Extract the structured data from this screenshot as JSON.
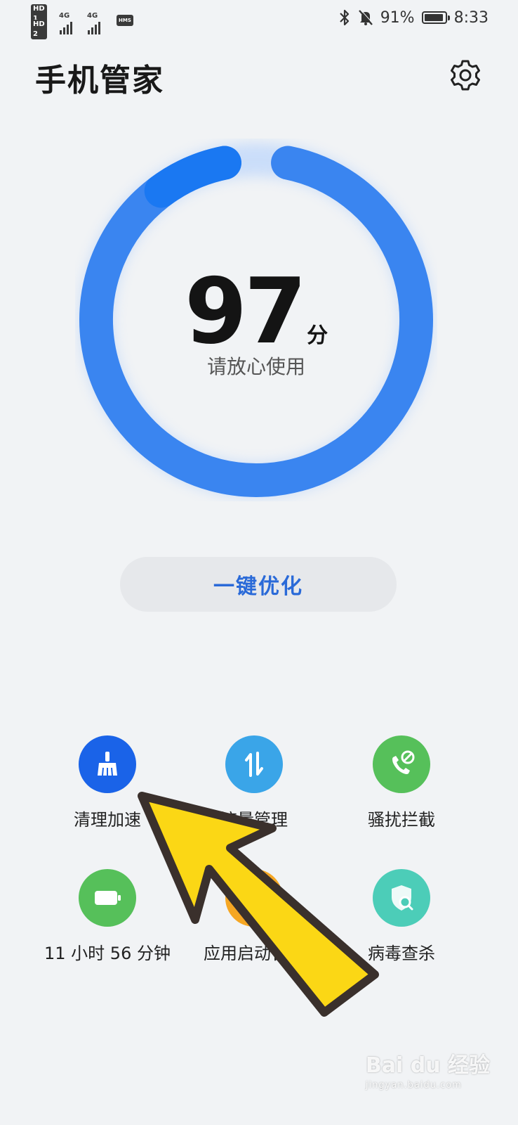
{
  "status_bar": {
    "left": {
      "hd1": "HD 1",
      "hd2": "HD 2",
      "net1": "4G",
      "net2": "4G",
      "hms": "HMS"
    },
    "battery_percent": "91%",
    "time": "8:33"
  },
  "header": {
    "title": "手机管家"
  },
  "score": {
    "value": "97",
    "unit": "分",
    "status": "请放心使用",
    "ring_fraction": 0.97
  },
  "optimize_button": {
    "label": "一键优化"
  },
  "features": [
    {
      "label": "清理加速",
      "icon": "broom-icon",
      "color": "#1a63e8"
    },
    {
      "label": "流量管理",
      "icon": "data-transfer-icon",
      "color": "#3aa5e8"
    },
    {
      "label": "骚扰拦截",
      "icon": "call-block-icon",
      "color": "#56c05a"
    },
    {
      "label": "11 小时 56 分钟",
      "icon": "battery-icon",
      "color": "#56c05a"
    },
    {
      "label": "应用启动管理",
      "icon": "app-launch-icon",
      "color": "#f5a623"
    },
    {
      "label": "病毒查杀",
      "icon": "virus-scan-icon",
      "color": "#4ccdb8"
    }
  ],
  "watermark": {
    "text": "Bai du 经验",
    "sub": "jingyan.baidu.com"
  },
  "colors": {
    "accent": "#2a6ad8",
    "ring": "#3a85f0",
    "background": "#f1f3f5"
  }
}
